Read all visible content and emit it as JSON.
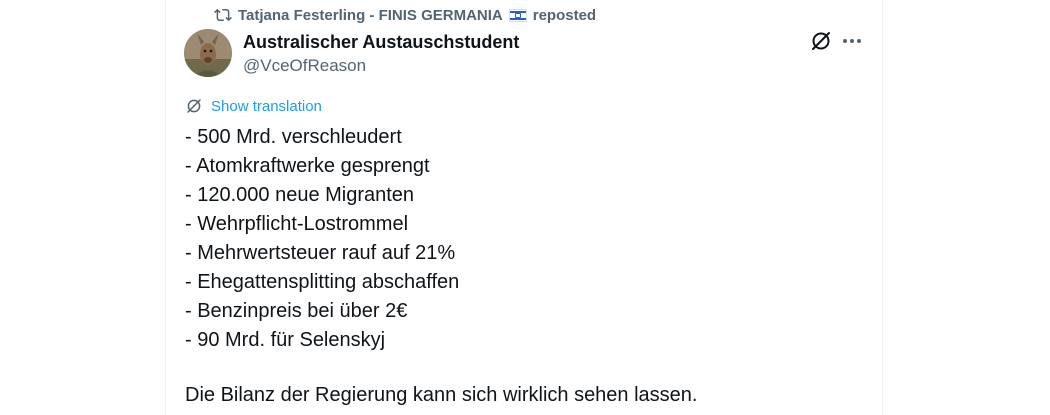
{
  "repost": {
    "reposter_name": "Tatjana Festerling - FINIS GERMANIA",
    "reposted_label": "reposted"
  },
  "author": {
    "display_name": "Australischer Austauschstudent",
    "handle": "@VceOfReason"
  },
  "actions": {
    "grok_icon": "grok-icon",
    "more_icon": "more-icon"
  },
  "translate": {
    "label": "Show translation"
  },
  "tweet": {
    "lines": [
      "- 500 Mrd. verschleudert",
      "- Atomkraftwerke gesprengt",
      "- 120.000 neue Migranten",
      "- Wehrpflicht-Lostrommel",
      "- Mehrwertsteuer rauf auf 21%",
      "- Ehegattensplitting abschaffen",
      "- Benzinpreis bei über 2€",
      "- 90 Mrd. für Selenskyj"
    ],
    "closing": "Die Bilanz der Regierung kann sich wirklich sehen lassen."
  },
  "colors": {
    "text_primary": "#0f1419",
    "text_secondary": "#536471",
    "link": "#1d9bf0",
    "border": "#eff3f4"
  }
}
